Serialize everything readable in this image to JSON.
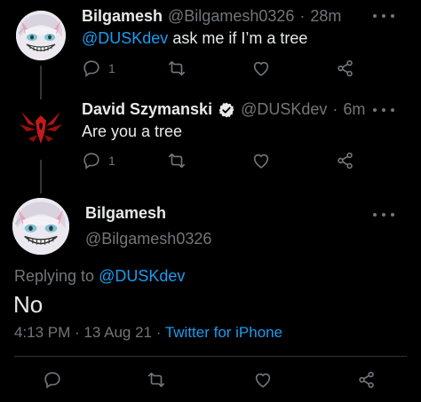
{
  "tweet1": {
    "name": "Bilgamesh",
    "handle": "@Bilgamesh0326",
    "separator": "·",
    "time": "28m",
    "mention": "@DUSKdev",
    "text": " ask me if I’m a tree",
    "reply_count": "1"
  },
  "tweet2": {
    "name": "David Szymanski",
    "handle": "@DUSKdev",
    "separator": "·",
    "time": "6m",
    "text": "Are you a tree",
    "reply_count": "1"
  },
  "main": {
    "name": "Bilgamesh",
    "handle": "@Bilgamesh0326",
    "replying_prefix": "Replying to ",
    "replying_to": "@DUSKdev",
    "text": "No",
    "time": "4:13 PM",
    "separator1": " · ",
    "date": "13 Aug 21",
    "separator2": " · ",
    "source": "Twitter for iPhone"
  },
  "icons": {
    "reply": "reply-bubble-icon",
    "retweet": "retweet-icon",
    "like": "heart-icon",
    "share": "share-icon",
    "verified": "verified-badge-icon",
    "more": "more-dots-icon"
  },
  "colors": {
    "background": "#000000",
    "text": "#e7e9ea",
    "muted": "#71767b",
    "accent": "#1d9bf0",
    "divider": "#2f3336"
  }
}
